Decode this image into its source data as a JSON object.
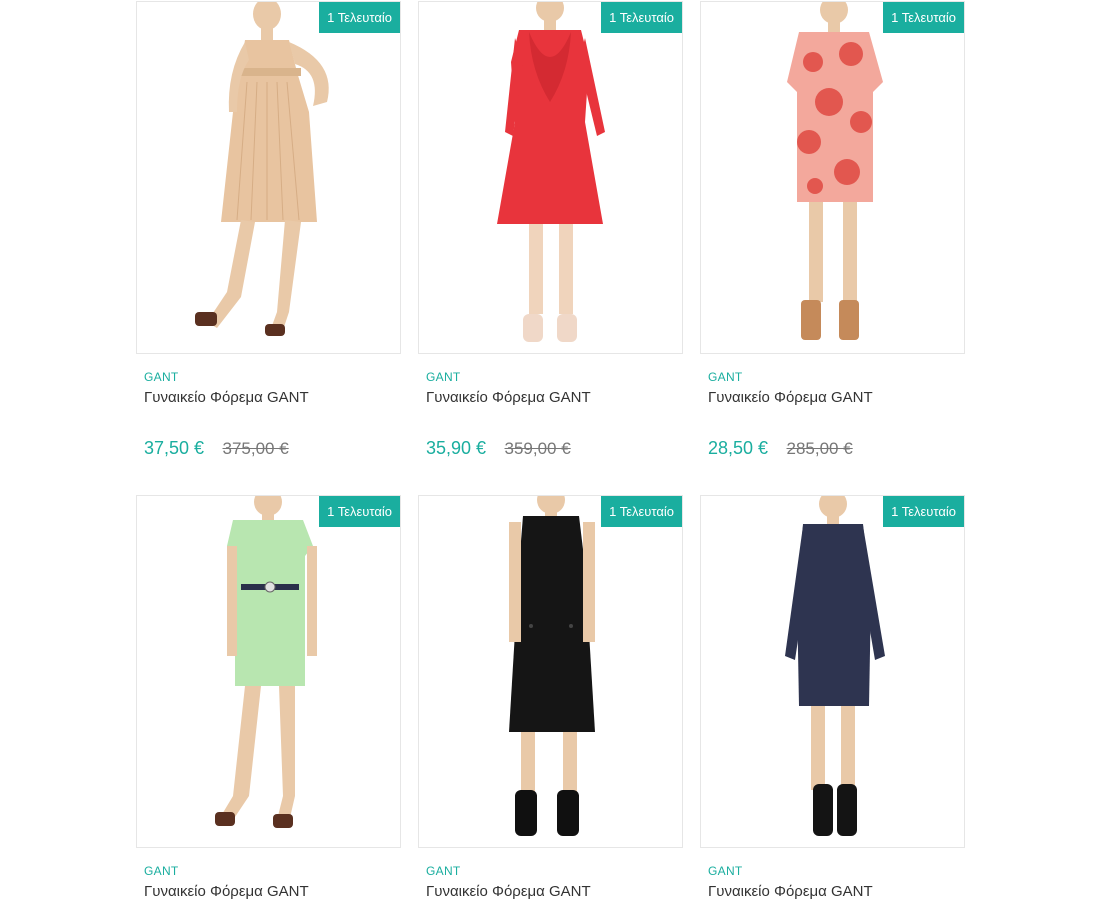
{
  "products": [
    {
      "badge": "1 Τελευταίο",
      "brand": "GANT",
      "title": "Γυναικείο Φόρεμα GANT",
      "price_new": "37,50 €",
      "price_old": "375,00 €",
      "dress_color": "#e8c4a0",
      "pattern": "pleated-beige"
    },
    {
      "badge": "1 Τελευταίο",
      "brand": "GANT",
      "title": "Γυναικείο Φόρεμα GANT",
      "price_new": "35,90 €",
      "price_old": "359,00 €",
      "dress_color": "#e8343c",
      "pattern": "red-ruffle"
    },
    {
      "badge": "1 Τελευταίο",
      "brand": "GANT",
      "title": "Γυναικείο Φόρεμα GANT",
      "price_new": "28,50 €",
      "price_old": "285,00 €",
      "dress_color": "#f09a90",
      "pattern": "floral-coral"
    },
    {
      "badge": "1 Τελευταίο",
      "brand": "GANT",
      "title": "Γυναικείο Φόρεμα GANT",
      "price_new": "",
      "price_old": "",
      "dress_color": "#b8e6b0",
      "pattern": "mint-belted"
    },
    {
      "badge": "1 Τελευταίο",
      "brand": "GANT",
      "title": "Γυναικείο Φόρεμα GANT",
      "price_new": "",
      "price_old": "",
      "dress_color": "#151515",
      "pattern": "black-sleeveless"
    },
    {
      "badge": "1 Τελευταίο",
      "brand": "GANT",
      "title": "Γυναικείο Φόρεμα GANT",
      "price_new": "",
      "price_old": "",
      "dress_color": "#2e3450",
      "pattern": "navy-longsleeve"
    }
  ],
  "colors": {
    "accent": "#1aae9f",
    "badge_text": "#ffffff",
    "old_price": "#777777",
    "title_text": "#333333"
  }
}
